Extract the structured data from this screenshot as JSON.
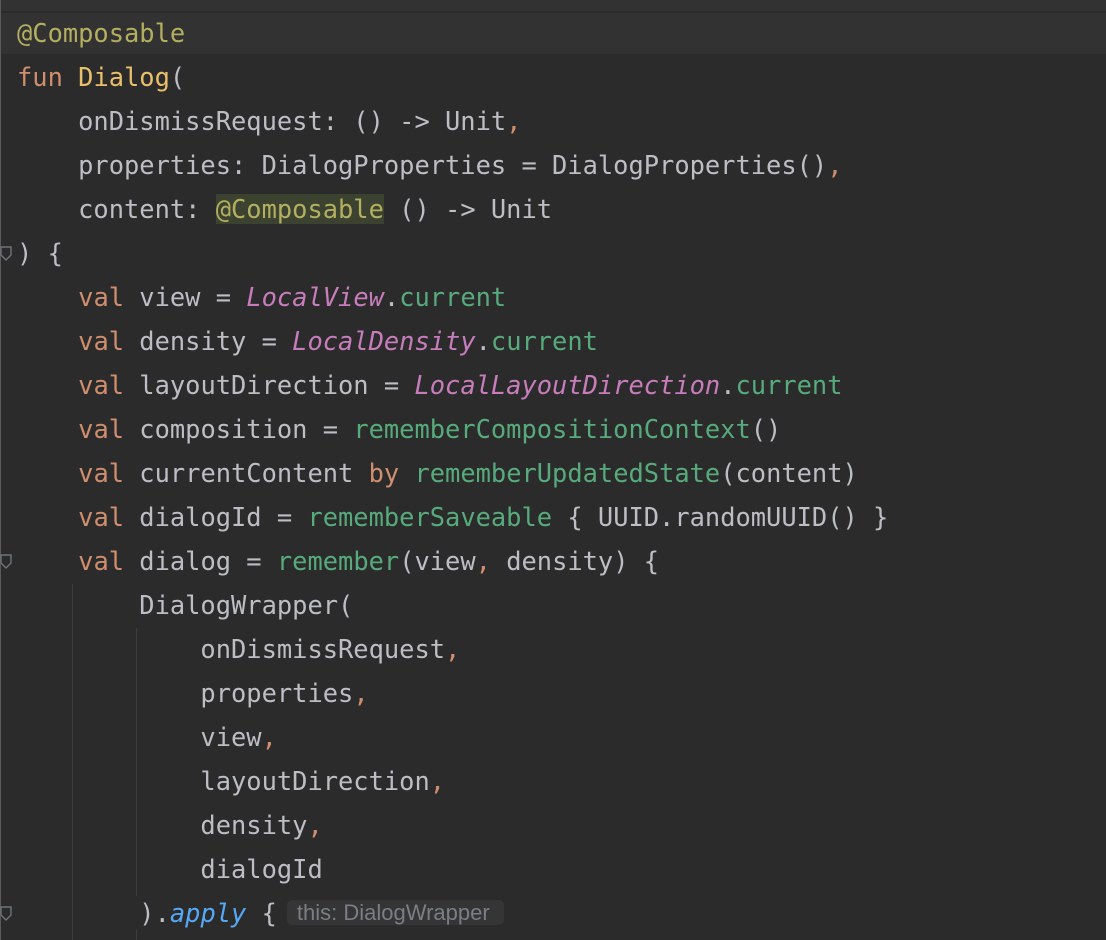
{
  "editor": {
    "lines": [
      [
        {
          "t": "@Composable",
          "c": "ann"
        }
      ],
      [
        {
          "t": "fun ",
          "c": "kw"
        },
        {
          "t": "Dialog",
          "c": "fn-decl dialog-name"
        },
        {
          "t": "(",
          "c": ""
        }
      ],
      [
        {
          "t": "    onDismissRequest: () -> Unit",
          "c": ""
        },
        {
          "t": ",",
          "c": "punc-o"
        }
      ],
      [
        {
          "t": "    properties: DialogProperties = DialogProperties()",
          "c": ""
        },
        {
          "t": ",",
          "c": "punc-o"
        }
      ],
      [
        {
          "t": "    content: ",
          "c": ""
        },
        {
          "t": "@Composable",
          "c": "ann ann-hl"
        },
        {
          "t": " () -> Unit",
          "c": ""
        }
      ],
      [
        {
          "t": ") {",
          "c": ""
        }
      ],
      [
        {
          "t": "    ",
          "c": ""
        },
        {
          "t": "val",
          "c": "kw"
        },
        {
          "t": " view = ",
          "c": ""
        },
        {
          "t": "LocalView",
          "c": "prop"
        },
        {
          "t": ".",
          "c": ""
        },
        {
          "t": "current",
          "c": "prop-plain"
        }
      ],
      [
        {
          "t": "    ",
          "c": ""
        },
        {
          "t": "val",
          "c": "kw"
        },
        {
          "t": " density = ",
          "c": ""
        },
        {
          "t": "LocalDensity",
          "c": "prop"
        },
        {
          "t": ".",
          "c": ""
        },
        {
          "t": "current",
          "c": "prop-plain"
        }
      ],
      [
        {
          "t": "    ",
          "c": ""
        },
        {
          "t": "val",
          "c": "kw"
        },
        {
          "t": " layoutDirection = ",
          "c": ""
        },
        {
          "t": "LocalLayoutDirection",
          "c": "prop"
        },
        {
          "t": ".",
          "c": ""
        },
        {
          "t": "current",
          "c": "prop-plain"
        }
      ],
      [
        {
          "t": "    ",
          "c": ""
        },
        {
          "t": "val",
          "c": "kw"
        },
        {
          "t": " composition = ",
          "c": ""
        },
        {
          "t": "rememberCompositionContext",
          "c": "fn-call"
        },
        {
          "t": "()",
          "c": ""
        }
      ],
      [
        {
          "t": "    ",
          "c": ""
        },
        {
          "t": "val",
          "c": "kw"
        },
        {
          "t": " currentContent ",
          "c": ""
        },
        {
          "t": "by",
          "c": "kw"
        },
        {
          "t": " ",
          "c": ""
        },
        {
          "t": "rememberUpdatedState",
          "c": "fn-call"
        },
        {
          "t": "(content)",
          "c": ""
        }
      ],
      [
        {
          "t": "    ",
          "c": ""
        },
        {
          "t": "val",
          "c": "kw"
        },
        {
          "t": " dialogId = ",
          "c": ""
        },
        {
          "t": "rememberSaveable",
          "c": "fn-call"
        },
        {
          "t": " { UUID.randomUUID() }",
          "c": ""
        }
      ],
      [
        {
          "t": "    ",
          "c": ""
        },
        {
          "t": "val",
          "c": "kw"
        },
        {
          "t": " dialog = ",
          "c": ""
        },
        {
          "t": "remember",
          "c": "fn-call"
        },
        {
          "t": "(view",
          "c": ""
        },
        {
          "t": ",",
          "c": "punc-o"
        },
        {
          "t": " density) {",
          "c": ""
        }
      ],
      [
        {
          "t": "        DialogWrapper(",
          "c": ""
        }
      ],
      [
        {
          "t": "            onDismissRequest",
          "c": ""
        },
        {
          "t": ",",
          "c": "punc-o"
        }
      ],
      [
        {
          "t": "            properties",
          "c": ""
        },
        {
          "t": ",",
          "c": "punc-o"
        }
      ],
      [
        {
          "t": "            view",
          "c": ""
        },
        {
          "t": ",",
          "c": "punc-o"
        }
      ],
      [
        {
          "t": "            layoutDirection",
          "c": ""
        },
        {
          "t": ",",
          "c": "punc-o"
        }
      ],
      [
        {
          "t": "            density",
          "c": ""
        },
        {
          "t": ",",
          "c": "punc-o"
        }
      ],
      [
        {
          "t": "            dialogId",
          "c": ""
        }
      ],
      [
        {
          "t": "        ).",
          "c": ""
        },
        {
          "t": "apply",
          "c": "ext"
        },
        {
          "t": " {",
          "c": ""
        }
      ]
    ],
    "inlay_hint": "this: DialogWrapper"
  }
}
